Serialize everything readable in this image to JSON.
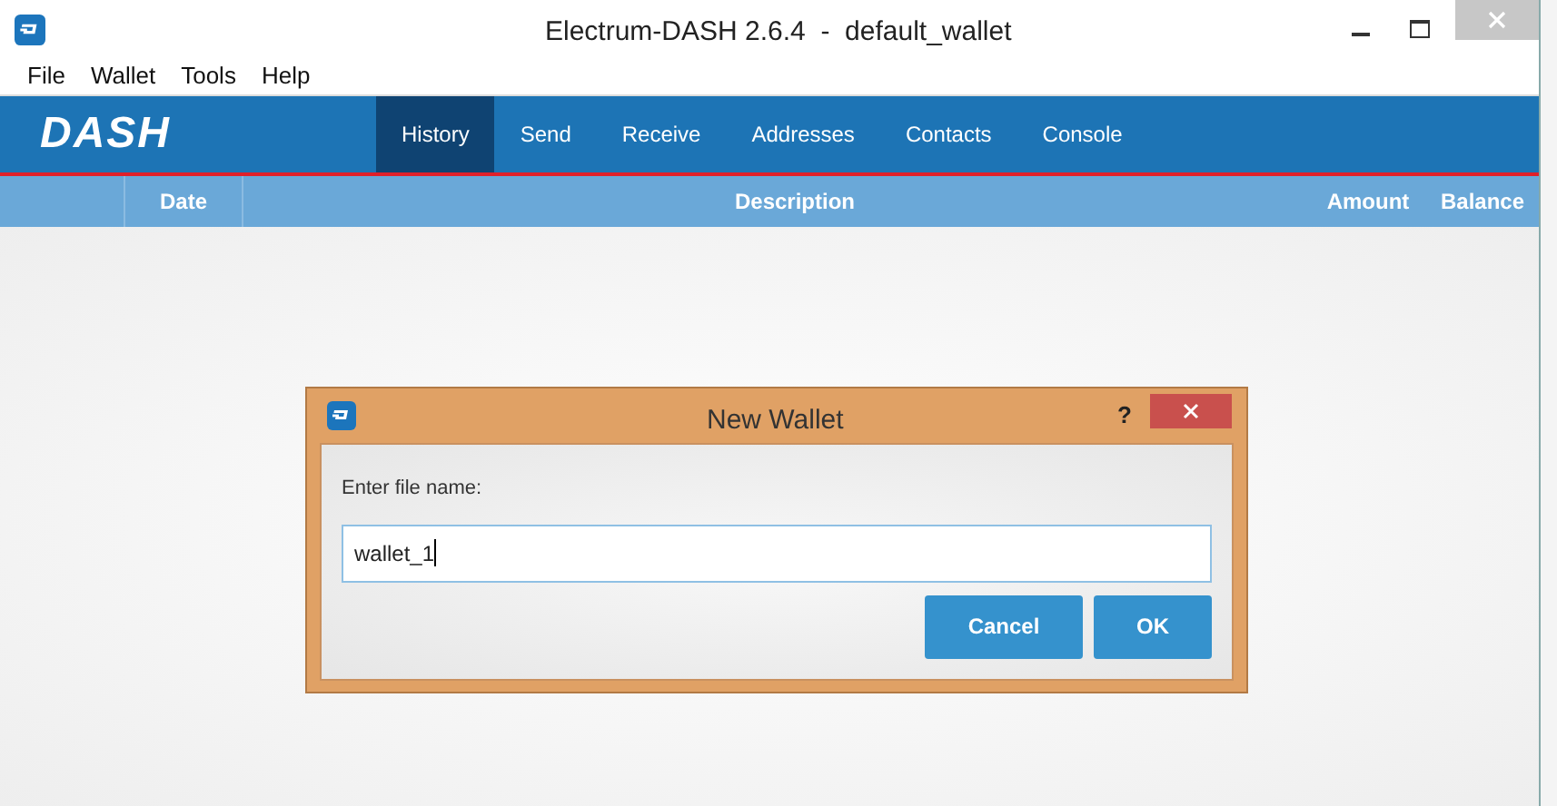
{
  "window": {
    "title": "Electrum-DASH 2.6.4  -  default_wallet"
  },
  "menu": [
    "File",
    "Wallet",
    "Tools",
    "Help"
  ],
  "logo": "DASH",
  "tabs": [
    {
      "label": "History",
      "selected": true
    },
    {
      "label": "Send",
      "selected": false
    },
    {
      "label": "Receive",
      "selected": false
    },
    {
      "label": "Addresses",
      "selected": false
    },
    {
      "label": "Contacts",
      "selected": false
    },
    {
      "label": "Console",
      "selected": false
    }
  ],
  "table": {
    "columns": [
      "Date",
      "Description",
      "Amount",
      "Balance"
    ]
  },
  "dialog": {
    "title": "New Wallet",
    "help": "?",
    "label": "Enter file name:",
    "value": "wallet_1",
    "buttons": [
      "Cancel",
      "OK"
    ]
  }
}
